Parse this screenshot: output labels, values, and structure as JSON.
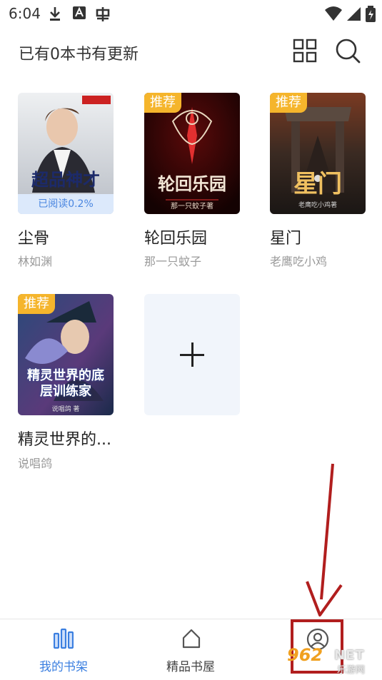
{
  "status_bar": {
    "time": "6:04"
  },
  "header": {
    "title": "已有0本书有更新",
    "grid_icon": "grid-view-icon",
    "search_icon": "search-icon"
  },
  "books": [
    {
      "title": "尘骨",
      "author": "林如渊",
      "cover_text": "超品神才",
      "progress": "已阅读0.2%",
      "badge": ""
    },
    {
      "title": "轮回乐园",
      "author": "那一只蚊子",
      "cover_text": "轮回乐园",
      "cover_sub": "那一只蚊子著",
      "badge": "推荐"
    },
    {
      "title": "星门",
      "author": "老鹰吃小鸡",
      "cover_text": "星门",
      "cover_sub": "老鹰吃小鸡著",
      "badge": "推荐"
    },
    {
      "title": "精灵世界的...",
      "author": "说唱鸽",
      "cover_text": "精灵世界的底层训练家",
      "cover_sub": "说唱鸽 著",
      "badge": "推荐"
    }
  ],
  "add_card": {
    "icon": "plus-icon"
  },
  "bottom_nav": {
    "items": [
      {
        "label": "我的书架",
        "icon": "bookshelf-icon",
        "active": true
      },
      {
        "label": "精品书屋",
        "icon": "house-icon",
        "active": false
      },
      {
        "label": "",
        "icon": "user-profile-icon",
        "active": false
      }
    ]
  },
  "watermark": {
    "number": "962",
    "suffix": "NET",
    "sub": "乐游网"
  },
  "colors": {
    "accent": "#3b7fe0",
    "badge": "#f5b52c",
    "annotation": "#b11e1e"
  }
}
